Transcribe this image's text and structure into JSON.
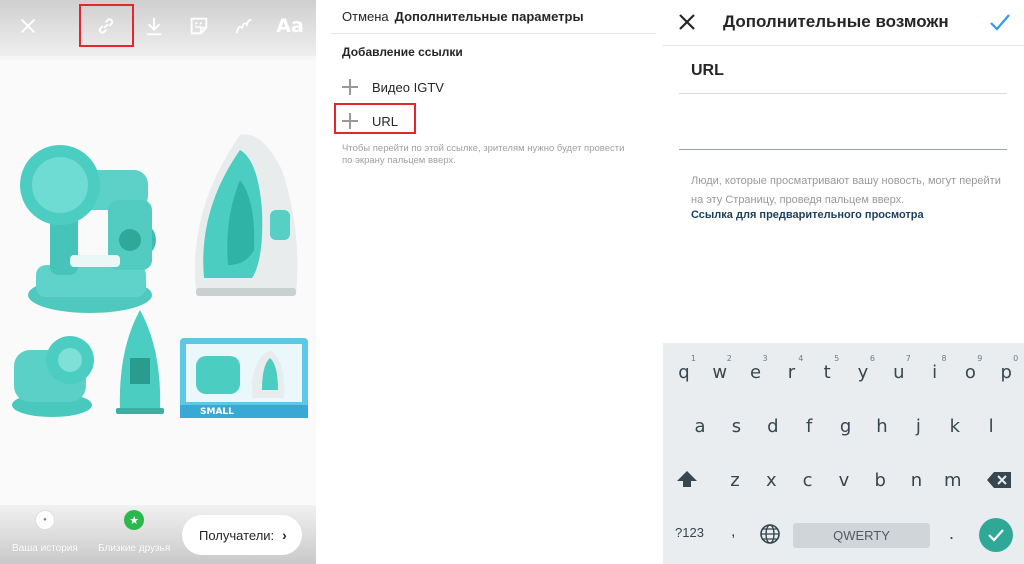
{
  "panel1": {
    "toolbar": {
      "close_icon": "close-icon",
      "link_icon": "link-icon",
      "download_icon": "download-icon",
      "sticker_icon": "sticker-icon",
      "draw_icon": "draw-icon",
      "text_label": "Aa"
    },
    "bottom": {
      "your_story": "Ваша история",
      "close_friends": "Близкие друзья",
      "recipients": "Получатели:",
      "recipients_chevron": "›"
    },
    "photo": {
      "box_text": "SMALL"
    },
    "highlight_color": "#e5262b"
  },
  "panel2": {
    "header": {
      "cancel": "Отмена",
      "title": "Дополнительные параметры"
    },
    "section_title": "Добавление ссылки",
    "items": [
      {
        "label": "Видео IGTV"
      },
      {
        "label": "URL"
      }
    ],
    "hint": "Чтобы перейти по этой ссылке, зрителям нужно будет провести по экрану пальцем вверх."
  },
  "panel3": {
    "header": {
      "title": "Дополнительные возможн"
    },
    "url_label": "URL",
    "url_value": "",
    "hint": "Люди, которые просматривают вашу новость, могут перейти на эту Страницу, проведя пальцем вверх.",
    "preview_link": "Ссылка для предварительного просмотра",
    "accent_color": "#2fa898",
    "keyboard": {
      "row1": [
        {
          "k": "q",
          "n": "1"
        },
        {
          "k": "w",
          "n": "2"
        },
        {
          "k": "e",
          "n": "3"
        },
        {
          "k": "r",
          "n": "4"
        },
        {
          "k": "t",
          "n": "5"
        },
        {
          "k": "y",
          "n": "6"
        },
        {
          "k": "u",
          "n": "7"
        },
        {
          "k": "i",
          "n": "8"
        },
        {
          "k": "o",
          "n": "9"
        },
        {
          "k": "p",
          "n": "0"
        }
      ],
      "row2": [
        "a",
        "s",
        "d",
        "f",
        "g",
        "h",
        "j",
        "k",
        "l"
      ],
      "row3": [
        "z",
        "x",
        "c",
        "v",
        "b",
        "n",
        "m"
      ],
      "mode": "?123",
      "comma": ",",
      "space": "QWERTY",
      "period": "."
    }
  }
}
